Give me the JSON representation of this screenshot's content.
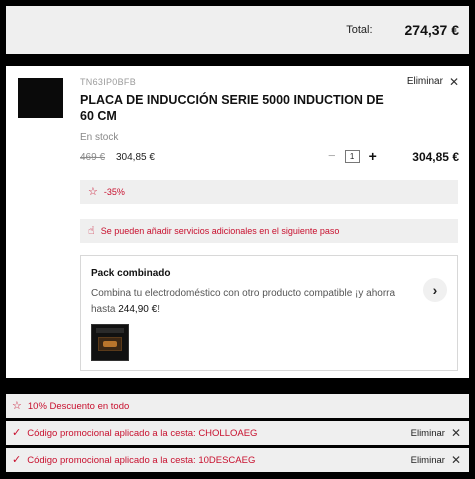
{
  "summary": {
    "total_label": "Total:",
    "total_value": "274,37 €"
  },
  "product": {
    "sku": "TN63IP0BFB",
    "title": "PLACA DE INDUCCIÓN SERIE 5000 INDUCTION DE 60 CM",
    "remove_label": "Eliminar",
    "stock": "En stock",
    "old_price": "469 €",
    "new_price": "304,85 €",
    "quantity": "1",
    "line_total": "304,85 €",
    "discount": "-35%",
    "services_note": "Se pueden añadir servicios adicionales en el siguiente paso"
  },
  "pack": {
    "title": "Pack combinado",
    "desc_text": "Combina tu electrodoméstico con otro producto compatible ¡y ahorra hasta ",
    "desc_price": "244,90 €",
    "desc_end": "!"
  },
  "promotions": [
    {
      "text": "10% Descuento en todo",
      "icon": "star-icon"
    },
    {
      "text": "Código promocional aplicado a la cesta: CHOLLOAEG",
      "icon": "check-icon",
      "remove_label": "Eliminar"
    },
    {
      "text": "Código promocional aplicado a la cesta: 10DESCAEG",
      "icon": "check-icon",
      "remove_label": "Eliminar"
    }
  ],
  "colors": {
    "accent_red": "#c8102e",
    "panel_gray": "#efefef"
  }
}
